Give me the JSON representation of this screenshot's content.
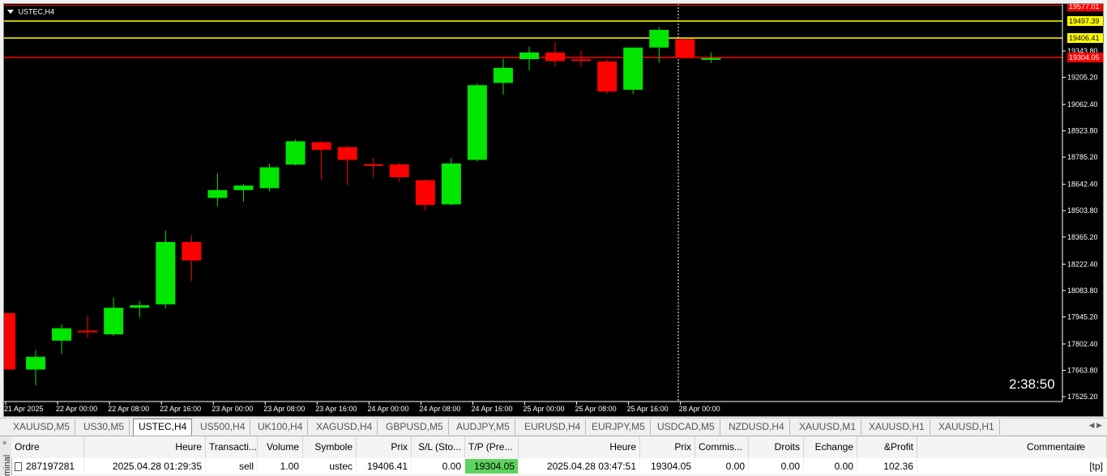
{
  "chart": {
    "symbol_label": "USTEC,H4",
    "timer": "2:38:50",
    "colors": {
      "bull": "#00e600",
      "bear": "#ff0000",
      "background": "#000000",
      "axis_text": "#ffffff",
      "level_line": "#ffff00",
      "tp_line": "#ff0000",
      "grid_dash": "#ffffff"
    },
    "price_axis": [
      "19343.80",
      "19205.20",
      "19062.40",
      "18923.80",
      "18785.20",
      "18642.40",
      "18503.80",
      "18365.20",
      "18222.40",
      "18083.80",
      "17945.20",
      "17802.40",
      "17663.80",
      "17525.20"
    ],
    "price_tags": [
      {
        "value": "19577.01",
        "style": "red"
      },
      {
        "value": "19497.39",
        "style": "yellow"
      },
      {
        "value": "19406.41",
        "style": "yellow"
      },
      {
        "value": "19304.05",
        "style": "red"
      }
    ],
    "time_axis": [
      "21 Apr 2025",
      "22 Apr 00:00",
      "22 Apr 08:00",
      "22 Apr 16:00",
      "23 Apr 00:00",
      "23 Apr 08:00",
      "23 Apr 16:00",
      "24 Apr 00:00",
      "24 Apr 08:00",
      "24 Apr 16:00",
      "25 Apr 00:00",
      "25 Apr 08:00",
      "25 Apr 16:00",
      "28 Apr 00:00"
    ]
  },
  "chart_data": {
    "type": "candlestick",
    "symbol": "USTEC",
    "timeframe": "H4",
    "ylim": [
      17525.2,
      19577.01
    ],
    "levels": [
      19497.39,
      19406.41,
      19304.05
    ],
    "candles": [
      {
        "o": 17965,
        "h": 17965,
        "l": 17668,
        "c": 17668
      },
      {
        "o": 17668,
        "h": 17770,
        "l": 17585,
        "c": 17735
      },
      {
        "o": 17820,
        "h": 17905,
        "l": 17750,
        "c": 17885
      },
      {
        "o": 17872,
        "h": 17952,
        "l": 17835,
        "c": 17865
      },
      {
        "o": 17853,
        "h": 18047,
        "l": 17845,
        "c": 17993
      },
      {
        "o": 17993,
        "h": 18027,
        "l": 17942,
        "c": 18006
      },
      {
        "o": 18011,
        "h": 18400,
        "l": 17990,
        "c": 18339
      },
      {
        "o": 18339,
        "h": 18375,
        "l": 18133,
        "c": 18242
      },
      {
        "o": 18571,
        "h": 18700,
        "l": 18527,
        "c": 18612
      },
      {
        "o": 18612,
        "h": 18642,
        "l": 18551,
        "c": 18636
      },
      {
        "o": 18622,
        "h": 18750,
        "l": 18606,
        "c": 18732
      },
      {
        "o": 18746,
        "h": 18878,
        "l": 18742,
        "c": 18869
      },
      {
        "o": 18864,
        "h": 18869,
        "l": 18664,
        "c": 18824
      },
      {
        "o": 18838,
        "h": 18841,
        "l": 18638,
        "c": 18771
      },
      {
        "o": 18748,
        "h": 18782,
        "l": 18680,
        "c": 18740
      },
      {
        "o": 18747,
        "h": 18755,
        "l": 18656,
        "c": 18680
      },
      {
        "o": 18664,
        "h": 18669,
        "l": 18505,
        "c": 18534
      },
      {
        "o": 18537,
        "h": 18781,
        "l": 18532,
        "c": 18752
      },
      {
        "o": 18771,
        "h": 19174,
        "l": 18764,
        "c": 19164
      },
      {
        "o": 19176,
        "h": 19303,
        "l": 19115,
        "c": 19255
      },
      {
        "o": 19301,
        "h": 19366,
        "l": 19243,
        "c": 19336
      },
      {
        "o": 19336,
        "h": 19391,
        "l": 19264,
        "c": 19291
      },
      {
        "o": 19300,
        "h": 19347,
        "l": 19260,
        "c": 19296
      },
      {
        "o": 19289,
        "h": 19298,
        "l": 19118,
        "c": 19131
      },
      {
        "o": 19140,
        "h": 19343,
        "l": 19118,
        "c": 19362
      },
      {
        "o": 19362,
        "h": 19469,
        "l": 19282,
        "c": 19455
      },
      {
        "o": 19406,
        "h": 19406,
        "l": 19304,
        "c": 19310
      },
      {
        "o": 19304,
        "h": 19336,
        "l": 19280,
        "c": 19306
      }
    ]
  },
  "tabs": [
    {
      "label": "XAUUSD,M5",
      "active": false
    },
    {
      "label": "US30,M5",
      "active": false
    },
    {
      "label": "USTEC,H4",
      "active": true
    },
    {
      "label": "US500,H4",
      "active": false
    },
    {
      "label": "UK100,H4",
      "active": false
    },
    {
      "label": "XAGUSD,H4",
      "active": false
    },
    {
      "label": "GBPUSD,M5",
      "active": false
    },
    {
      "label": "AUDJPY,M5",
      "active": false
    },
    {
      "label": "EURUSD,H4",
      "active": false
    },
    {
      "label": "EURJPY,M5",
      "active": false
    },
    {
      "label": "USDCAD,M5",
      "active": false
    },
    {
      "label": "NZDUSD,H4",
      "active": false
    },
    {
      "label": "XAUUSD,M1",
      "active": false
    },
    {
      "label": "XAUUSD,H1",
      "active": false
    },
    {
      "label": "XAUUSD,H1",
      "active": false
    }
  ],
  "tab_scroll": "◀ ▶",
  "terminal": {
    "side_label": "minal",
    "close_icon": "×",
    "headers": {
      "order": "Ordre",
      "open_time": "Heure",
      "type": "Transacti...",
      "volume": "Volume",
      "symbol": "Symbole",
      "open_price": "Prix",
      "sl": "S/L (Sto...",
      "tp": "T/P (Pre...",
      "close_time": "Heure",
      "close_price": "Prix",
      "commission": "Commis...",
      "fees": "Droits",
      "swap": "Echange",
      "profit": "&Profit",
      "comment": "Commentaire",
      "sort": "/"
    },
    "row": {
      "order": "287197281",
      "open_time": "2025.04.28 01:29:35",
      "type": "sell",
      "volume": "1.00",
      "symbol": "ustec",
      "open_price": "19406.41",
      "sl": "0.00",
      "tp": "19304.05",
      "close_time": "2025.04.28 03:47:51",
      "close_price": "19304.05",
      "commission": "0.00",
      "fees": "0.00",
      "swap": "0.00",
      "profit": "102.36",
      "comment": "[tp]"
    }
  }
}
